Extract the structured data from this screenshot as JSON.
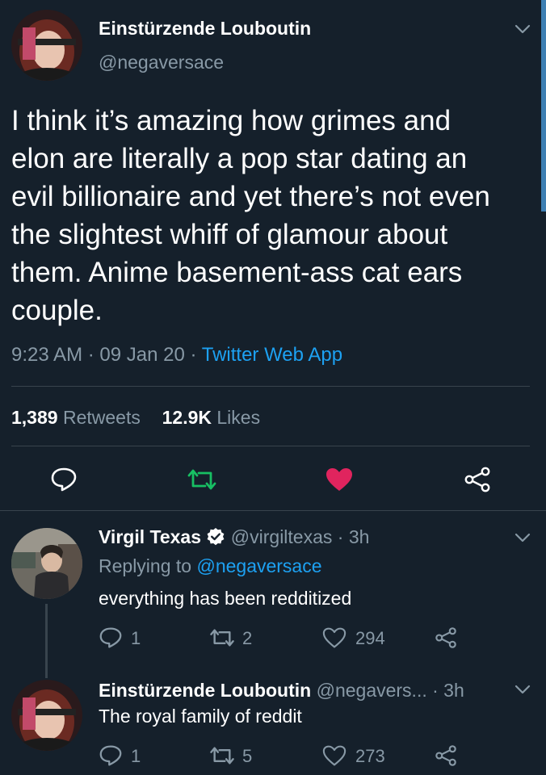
{
  "main_tweet": {
    "display_name": "Einstürzende Louboutin",
    "handle": "@negaversace",
    "text_lines": [
      "I think it’s amazing how grimes and",
      "elon are literally a pop star dating an",
      "evil billionaire and yet there’s not even",
      "the slightest whiff of glamour about",
      "them. Anime basement-ass cat ears",
      "couple."
    ],
    "time": "9:23 AM",
    "date": "09 Jan 20",
    "source": "Twitter Web App",
    "retweets_count": "1,389",
    "retweets_label": "Retweets",
    "likes_count": "12.9K",
    "likes_label": "Likes"
  },
  "reply1": {
    "display_name": "Virgil Texas",
    "verified_icon": "verified-badge-icon",
    "handle": "@virgiltexas",
    "time": "· 3h",
    "replying_prefix": "Replying to",
    "replying_handle": "@negaversace",
    "text": "everything has been redditized",
    "replies": "1",
    "retweets": "2",
    "likes": "294"
  },
  "reply2": {
    "display_name": "Einstürzende Louboutin",
    "handle": "@negavers...",
    "time": "· 3h",
    "text": "The royal family of reddit",
    "replies": "1",
    "retweets": "5",
    "likes": "273"
  },
  "colors": {
    "background": "#15202b",
    "muted": "#8899a6",
    "link": "#1da1f2",
    "retweet_active": "#17bf63",
    "like_active": "#e0245e",
    "divider": "#38444d"
  }
}
